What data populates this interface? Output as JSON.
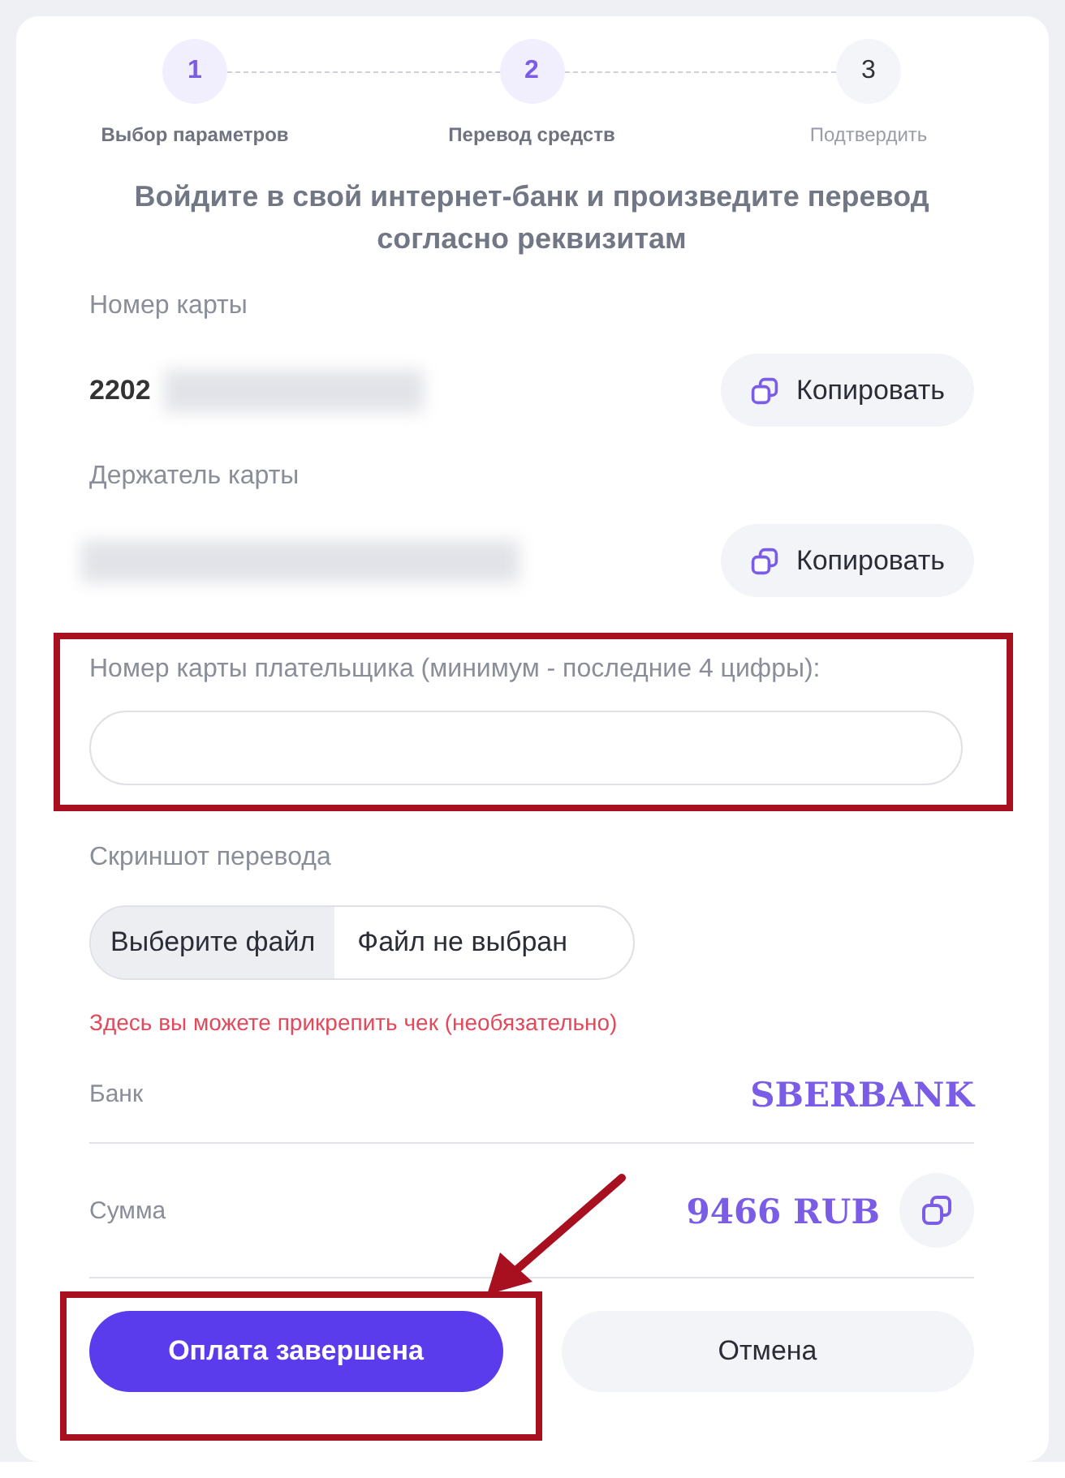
{
  "steps": [
    {
      "number": "1",
      "label": "Выбор параметров",
      "reached": true
    },
    {
      "number": "2",
      "label": "Перевод средств",
      "reached": true
    },
    {
      "number": "3",
      "label": "Подтвердить",
      "reached": false
    }
  ],
  "heading": "Войдите в свой интернет-банк и произведите перевод согласно реквизитам",
  "card_number": {
    "label": "Номер карты",
    "value": "2202",
    "copy_button": "Копировать"
  },
  "card_holder": {
    "label": "Держатель карты",
    "copy_button": "Копировать"
  },
  "payer_card": {
    "label": "Номер карты плательщика (минимум - последние 4 цифры):"
  },
  "screenshot": {
    "label": "Скриншот перевода",
    "choose_button": "Выберите файл",
    "file_status": "Файл не выбран",
    "hint": "Здесь вы можете прикрепить чек (необязательно)"
  },
  "details": [
    {
      "label": "Банк",
      "value": "SBERBANK",
      "copyable": false
    },
    {
      "label": "Сумма",
      "value": "9466 RUB",
      "copyable": true
    }
  ],
  "buttons": [
    {
      "label": "Оплата завершена",
      "kind": "primary"
    },
    {
      "label": "Отмена",
      "kind": "secondary"
    }
  ]
}
